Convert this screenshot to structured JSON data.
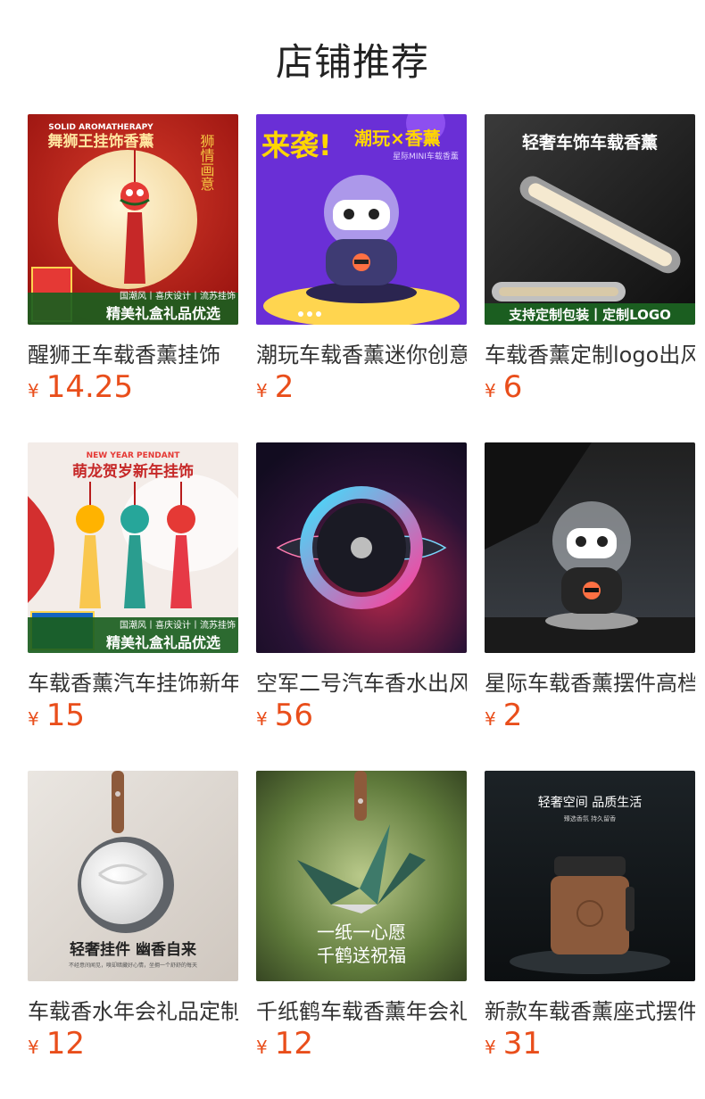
{
  "header": {
    "title": "店铺推荐"
  },
  "currency_symbol": "¥",
  "colors": {
    "price": "#e94e1b",
    "title": "#333333"
  },
  "products": [
    {
      "title": "醒狮王车载香薰挂饰",
      "price": "14.25",
      "image_text": {
        "line1": "SOLID AROMATHERAPY",
        "line2": "舞狮王挂饰香薰",
        "side": "狮情画意",
        "tags": "国潮风丨喜庆设计丨流苏挂饰",
        "banner": "精美礼盒礼品优选"
      }
    },
    {
      "title": "潮玩车载香薰迷你创意",
      "price": "2",
      "image_text": {
        "line1": "来袭!",
        "line2": "潮玩×香薰",
        "line3": "星际MINI车载香薰"
      }
    },
    {
      "title": "车载香薰定制logo出风口",
      "price": "6",
      "image_text": {
        "line1": "轻奢车饰车载香薰",
        "banner": "支持定制包装丨定制LOGO"
      }
    },
    {
      "title": "车载香薰汽车挂饰新年",
      "price": "15",
      "image_text": {
        "line1": "NEW YEAR PENDANT",
        "line2": "萌龙贺岁新年挂饰",
        "tags": "国潮风丨喜庆设计丨流苏挂饰",
        "banner": "精美礼盒礼品优选"
      }
    },
    {
      "title": "空军二号汽车香水出风口",
      "price": "56",
      "image_text": {}
    },
    {
      "title": "星际车载香薰摆件高档",
      "price": "2",
      "image_text": {}
    },
    {
      "title": "车载香水年会礼品定制",
      "price": "12",
      "image_text": {
        "line1": "轻奢挂件 幽香自来",
        "line2": "不经意间闻见，嗅却暗藏好心情，坐拥一个舒舒的每天"
      }
    },
    {
      "title": "千纸鹤车载香薰年会礼品",
      "price": "12",
      "image_text": {
        "line1": "一纸一心愿",
        "line2": "千鹤送祝福"
      }
    },
    {
      "title": "新款车载香薰座式摆件",
      "price": "31",
      "image_text": {
        "line1": "轻奢空间 品质生活",
        "line2": "臻选香氛 持久留香"
      }
    }
  ]
}
